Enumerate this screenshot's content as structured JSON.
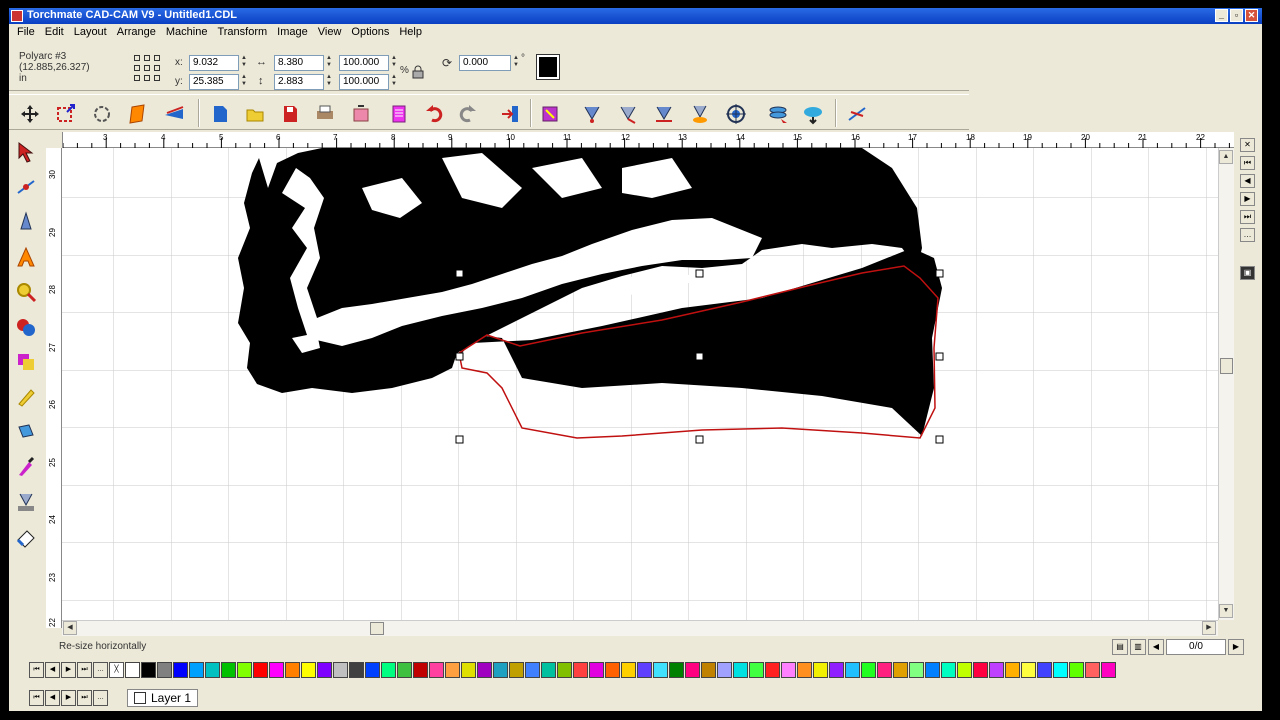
{
  "window": {
    "title": "Torchmate CAD-CAM V9 - Untitled1.CDL",
    "min_label": "_",
    "max_label": "▫",
    "close_label": "✕"
  },
  "menu": [
    "File",
    "Edit",
    "Layout",
    "Arrange",
    "Machine",
    "Transform",
    "Image",
    "View",
    "Options",
    "Help"
  ],
  "object_info": {
    "name": "Polyarc #3",
    "coords": "(12.885,26.327)",
    "units": "in"
  },
  "props": {
    "x_label": "x:",
    "y_label": "y:",
    "x": "9.032",
    "y": "25.385",
    "w": "8.380",
    "h": "2.883",
    "scale_w": "100.000",
    "scale_h": "100.000",
    "rotation": "0.000",
    "degree_symbol": "°",
    "percent_symbol": "%",
    "fill_color": "#000000"
  },
  "ruler": {
    "h_ticks": [
      "3",
      "4",
      "5",
      "6",
      "7",
      "8",
      "9",
      "10",
      "11",
      "12",
      "13",
      "14",
      "15",
      "16",
      "17",
      "18",
      "19",
      "20",
      "21",
      "22"
    ],
    "v_ticks": [
      "30",
      "29",
      "28",
      "27",
      "26",
      "25",
      "24",
      "23",
      "22"
    ]
  },
  "status": {
    "text": "Re-size horizontally",
    "page": "0/0"
  },
  "layers": {
    "active": "Layer 1"
  },
  "palette": [
    "#ffffff",
    "#000000",
    "#808080",
    "#0000ff",
    "#00a0ff",
    "#00c0c0",
    "#00c000",
    "#80ff00",
    "#ff0000",
    "#ff00ff",
    "#ff8000",
    "#ffff00",
    "#8000ff",
    "#c0c0c0",
    "#404040",
    "#0040ff",
    "#00ff80",
    "#40c040",
    "#c00000",
    "#ff40a0",
    "#ffa040",
    "#e0e000",
    "#a000c0",
    "#20a0c0",
    "#c0a000",
    "#4080ff",
    "#00c0a0",
    "#80c000",
    "#ff4040",
    "#e000e0",
    "#ff6000",
    "#ffd000",
    "#6040ff",
    "#40e0ff",
    "#008000",
    "#ff0080",
    "#c08000",
    "#a0a0ff",
    "#00e0e0",
    "#40ff40",
    "#ff2020",
    "#ff80ff",
    "#ff9020",
    "#f0f000",
    "#9020ff",
    "#20c0ff",
    "#20ff20",
    "#ff2080",
    "#e0a000",
    "#80ff80",
    "#0080ff",
    "#00ffc0",
    "#c0ff00",
    "#ff0040",
    "#c040ff",
    "#ffb000",
    "#ffff40",
    "#4040ff",
    "#00ffff",
    "#60ff00",
    "#ff6060",
    "#ff00c0",
    "#ff8040",
    "#e0e040",
    "#a040ff",
    "#40c0ff",
    "#40ff80",
    "#ff4080",
    "#ffc040",
    "#20e0e0"
  ]
}
